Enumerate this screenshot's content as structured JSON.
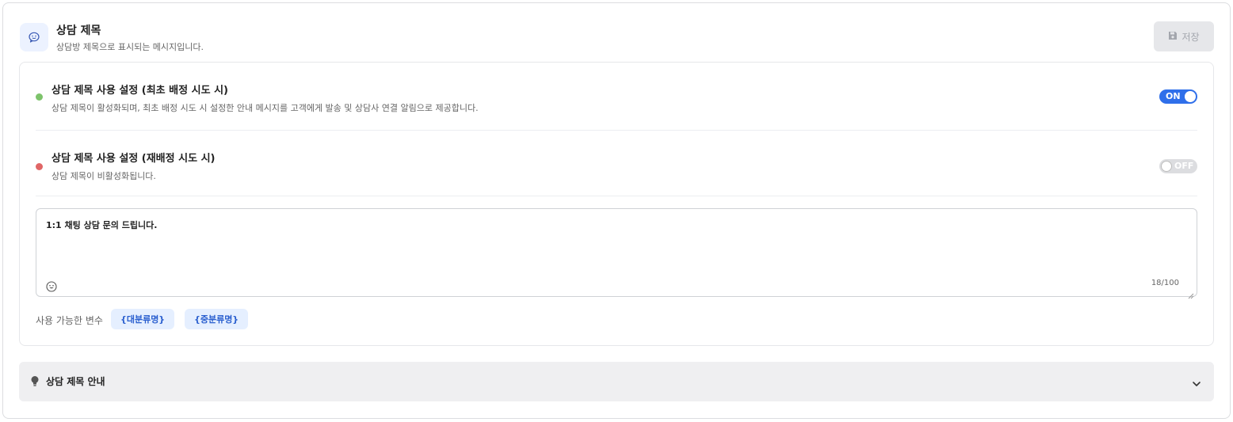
{
  "header": {
    "icon": "chat-bubble-icon",
    "title": "상담 제목",
    "description": "상담방 제목으로 표시되는 메시지입니다.",
    "save_label": "저장",
    "save_icon": "floppy-disk-icon"
  },
  "settings": [
    {
      "status_color": "#7dc36b",
      "title": "상담 제목 사용 설정 (최초 배정 시도 시)",
      "description": "상담 제목이 활성화되며, 최초 배정 시도 시 설정한 안내 메시지를 고객에게 발송 및 상담사 연결 알림으로 제공합니다.",
      "toggle": "ON"
    },
    {
      "status_color": "#e06666",
      "title": "상담 제목 사용 설정 (재배정 시도 시)",
      "description": "상담 제목이 비활성화됩니다.",
      "toggle": "OFF"
    }
  ],
  "editor": {
    "value": "1:1 채팅 상담 문의 드립니다.",
    "char_count": "18/100",
    "emoji_icon": "smiley-icon"
  },
  "variables": {
    "label": "사용 가능한 변수",
    "chips": [
      "{대분류명}",
      "{중분류명}"
    ]
  },
  "guide": {
    "icon": "lightbulb-icon",
    "title": "상담 제목 안내",
    "chevron": "chevron-down-icon"
  },
  "colors": {
    "accent": "#2f6fea",
    "chip_bg": "#e5efff",
    "chip_text": "#2a5fcf"
  }
}
